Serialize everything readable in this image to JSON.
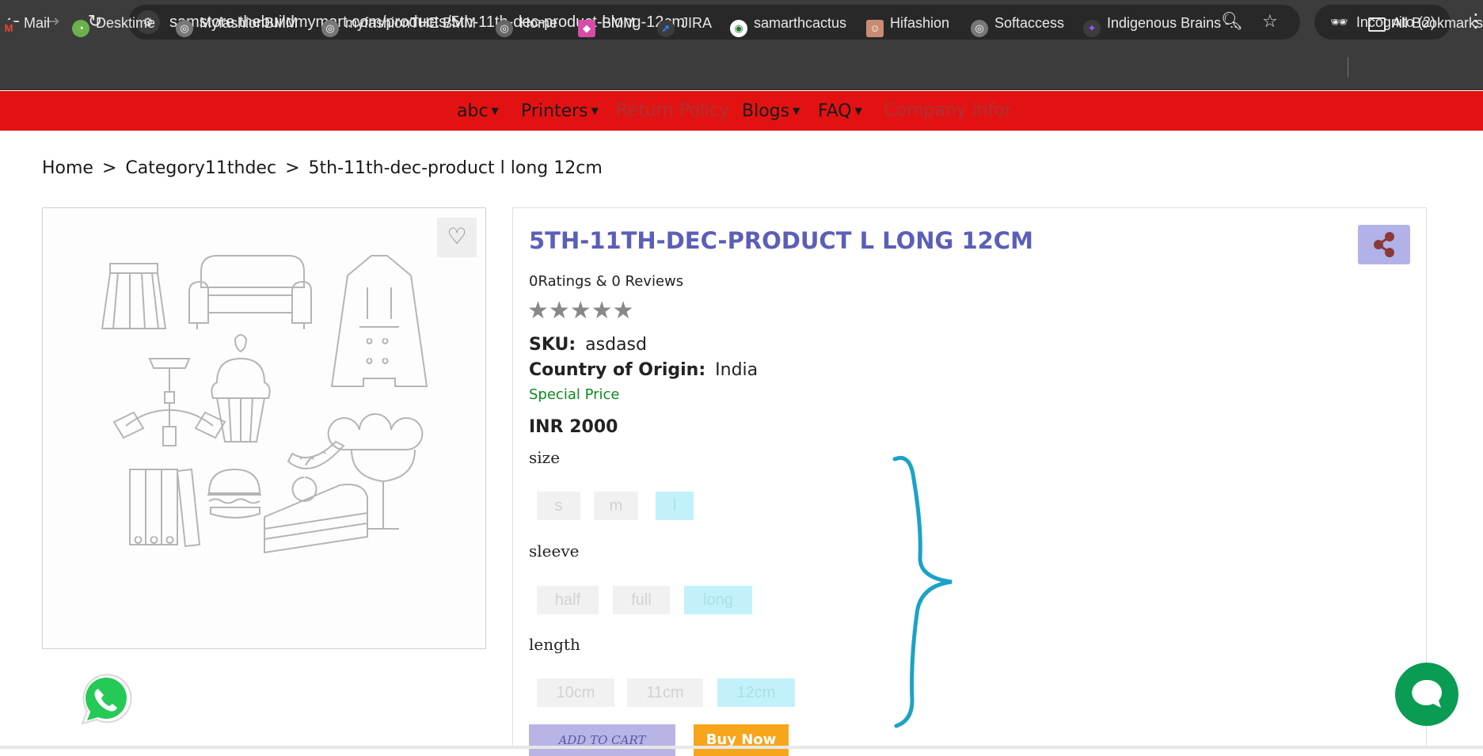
{
  "browser": {
    "url": "samstore.thebuildmymart.com/products/5th-11th-dec-product-l-long-12cm",
    "incognito_label": "Incognito (2)",
    "bookmarks": [
      {
        "label": "Mail",
        "icon": "gmail-icon"
      },
      {
        "label": "Desktime",
        "icon": "desktime-icon"
      },
      {
        "label": "MyfashionBMM",
        "icon": "globe-icon"
      },
      {
        "label": "myfashionTHE BMM",
        "icon": "globe-icon"
      },
      {
        "label": "Home",
        "icon": "globe-icon"
      },
      {
        "label": "BMM",
        "icon": "bmm-icon"
      },
      {
        "label": "JIRA",
        "icon": "jira-icon"
      },
      {
        "label": "samarthcactus",
        "icon": "cactus-icon"
      },
      {
        "label": "Hifashion",
        "icon": "hifashion-icon"
      },
      {
        "label": "Softaccess",
        "icon": "globe-icon"
      },
      {
        "label": "Indigenous Brains -...",
        "icon": "indigenous-brains-icon"
      }
    ],
    "all_bookmarks_label": "All Bookmarks"
  },
  "site_nav": {
    "items": [
      {
        "label": "abc",
        "dropdown": true
      },
      {
        "label": "Printers",
        "dropdown": true
      },
      {
        "label": "Return Policy",
        "dropdown": false
      },
      {
        "label": "Blogs",
        "dropdown": true
      },
      {
        "label": "FAQ",
        "dropdown": true
      },
      {
        "label": "Company infor",
        "dropdown": false
      }
    ],
    "bar_color": "#e31212"
  },
  "breadcrumb": {
    "home": "Home",
    "sep": ">",
    "category": "Category11thdec",
    "current": "5th-11th-dec-product l long 12cm"
  },
  "product": {
    "title": "5TH-11TH-DEC-PRODUCT L LONG 12CM",
    "ratings_text": "0Ratings & 0 Reviews",
    "stars": "★★★★★",
    "sku_label": "SKU:",
    "sku_value": "asdasd",
    "origin_label": "Country of Origin:",
    "origin_value": "India",
    "special_price_label": "Special Price",
    "price": "INR 2000",
    "options": {
      "size": {
        "label": "size",
        "values": [
          "s",
          "m",
          "l"
        ],
        "selected": "l"
      },
      "sleeve": {
        "label": "sleeve",
        "values": [
          "half",
          "full",
          "long"
        ],
        "selected": "long"
      },
      "length": {
        "label": "length",
        "values": [
          "10cm",
          "11cm",
          "12cm"
        ],
        "selected": "12cm"
      }
    },
    "add_to_cart_label": "ADD TO CART",
    "buy_now_label": "Buy Now",
    "title_color": "#5b5fb8",
    "buy_color": "#f7a51b"
  }
}
